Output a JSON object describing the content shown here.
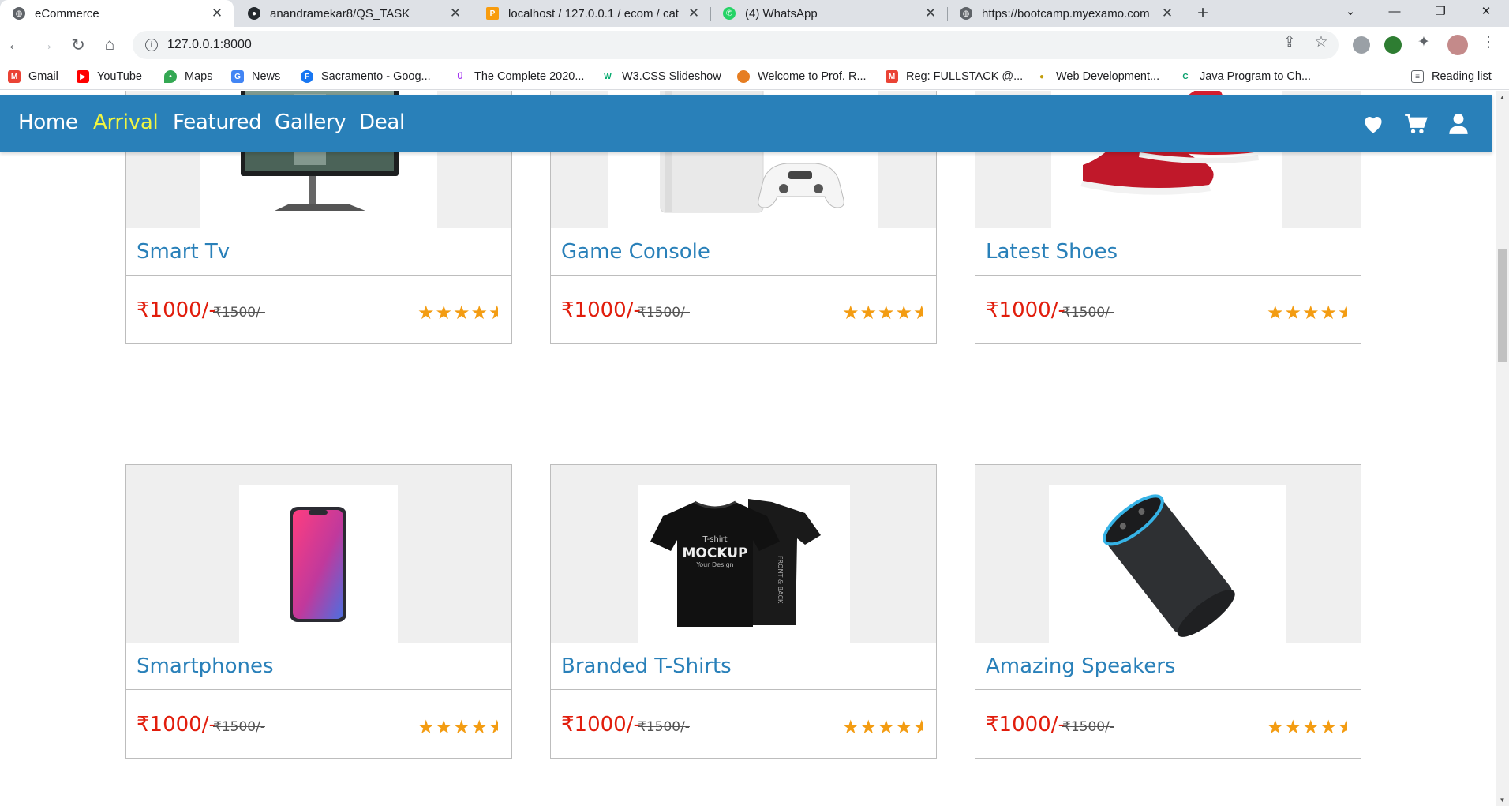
{
  "browser": {
    "tabs": [
      {
        "title": "eCommerce",
        "active": true
      },
      {
        "title": "anandramekar8/QS_TASK",
        "active": false
      },
      {
        "title": "localhost / 127.0.0.1 / ecom / cat",
        "active": false
      },
      {
        "title": "(4) WhatsApp",
        "active": false
      },
      {
        "title": "https://bootcamp.myexamo.com",
        "active": false
      }
    ],
    "url": "127.0.0.1:8000",
    "bookmarks": [
      {
        "label": "Gmail",
        "icon": "gmail-icon",
        "color": "#ea4335"
      },
      {
        "label": "YouTube",
        "icon": "youtube-icon",
        "color": "#ff0000"
      },
      {
        "label": "Maps",
        "icon": "maps-icon",
        "color": "#34a853"
      },
      {
        "label": "News",
        "icon": "news-icon",
        "color": "#4285f4"
      },
      {
        "label": "Sacramento - Goog...",
        "icon": "facebook-icon",
        "color": "#1877f2"
      },
      {
        "label": "The Complete 2020...",
        "icon": "udemy-icon",
        "color": "#a435f0"
      },
      {
        "label": "W3.CSS Slideshow",
        "icon": "w3schools-icon",
        "color": "#04aa6d"
      },
      {
        "label": "Welcome to Prof. R...",
        "icon": "avatar-icon",
        "color": "#e67e22"
      },
      {
        "label": "Reg: FULLSTACK @...",
        "icon": "gmail-icon",
        "color": "#ea4335"
      },
      {
        "label": "Web Development...",
        "icon": "bulb-icon",
        "color": "#f1c40f"
      },
      {
        "label": "Java Program to Ch...",
        "icon": "programiz-icon",
        "color": "#0aa06e"
      }
    ],
    "reading_list": "Reading list"
  },
  "site": {
    "nav": [
      {
        "label": "Home",
        "active": false
      },
      {
        "label": "Arrival",
        "active": true
      },
      {
        "label": "Featured",
        "active": false
      },
      {
        "label": "Gallery",
        "active": false
      },
      {
        "label": "Deal",
        "active": false
      }
    ],
    "icons": [
      "heart-icon",
      "cart-icon",
      "user-icon"
    ],
    "colors": {
      "header": "#2980b9",
      "active_link": "#f1f541",
      "title": "#2980b9",
      "price": "#e11d0c",
      "stars": "#f39c12"
    }
  },
  "products": [
    {
      "name": "Smart Tv",
      "price": "₹1000/-",
      "old_price": "₹1500/-",
      "rating": 4.5,
      "image": "smart-tv-image"
    },
    {
      "name": "Game Console",
      "price": "₹1000/-",
      "old_price": "₹1500/-",
      "rating": 4.5,
      "image": "game-console-image"
    },
    {
      "name": "Latest Shoes",
      "price": "₹1000/-",
      "old_price": "₹1500/-",
      "rating": 4.5,
      "image": "shoes-image"
    },
    {
      "name": "Smartphones",
      "price": "₹1000/-",
      "old_price": "₹1500/-",
      "rating": 4.5,
      "image": "smartphone-image"
    },
    {
      "name": "Branded T-Shirts",
      "price": "₹1000/-",
      "old_price": "₹1500/-",
      "rating": 4.5,
      "image": "tshirt-image",
      "image_text": [
        "T-shirt",
        "MOCKUP",
        "Your Design",
        "FRONT & BACK"
      ]
    },
    {
      "name": "Amazing Speakers",
      "price": "₹1000/-",
      "old_price": "₹1500/-",
      "rating": 4.5,
      "image": "speaker-image"
    }
  ]
}
